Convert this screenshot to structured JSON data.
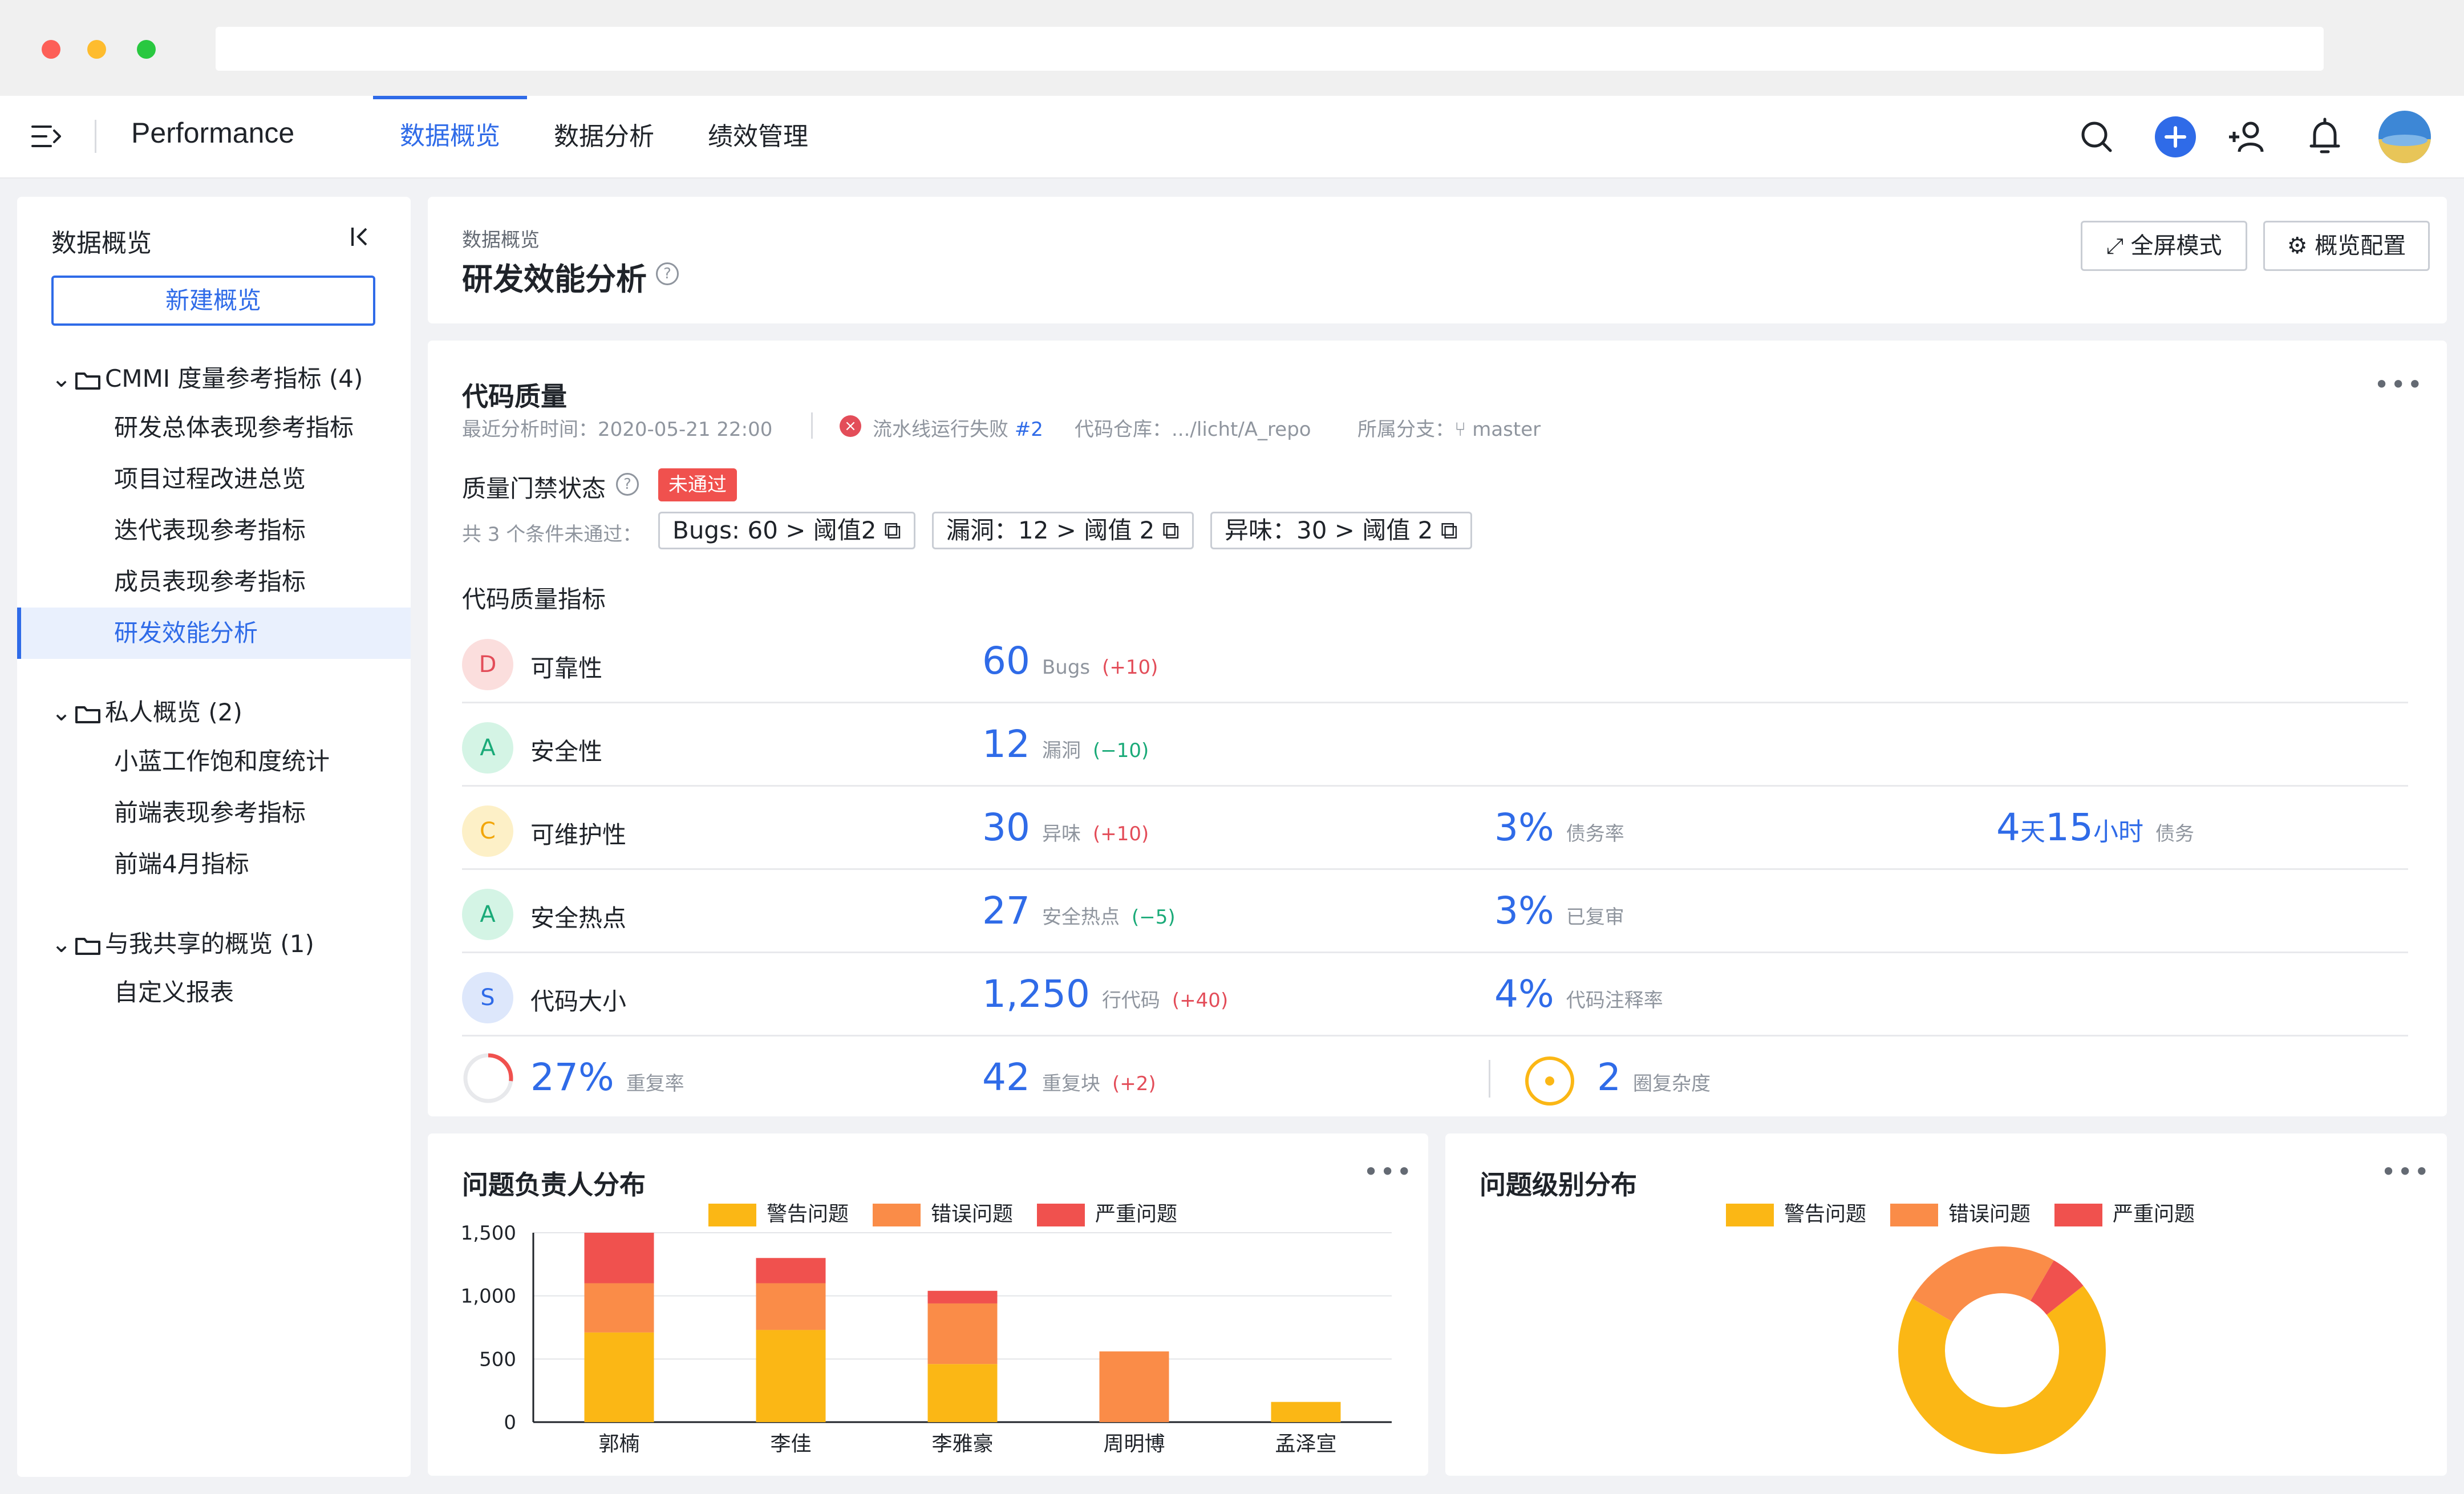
{
  "colors": {
    "accent": "#2f6be8",
    "warning": "#fbb715",
    "error": "#fa8c48",
    "critical": "#f0514e",
    "fail_badge": "#f0514e"
  },
  "header": {
    "app_title": "Performance",
    "tabs": [
      {
        "label": "数据概览",
        "active": true
      },
      {
        "label": "数据分析",
        "active": false
      },
      {
        "label": "绩效管理",
        "active": false
      }
    ],
    "icons": [
      "search-icon",
      "add-icon",
      "add-user-icon",
      "bell-icon",
      "avatar"
    ]
  },
  "sidebar": {
    "title": "数据概览",
    "new_button": "新建概览",
    "groups": [
      {
        "label": "CMMI 度量参考指标 (4)",
        "items": [
          "研发总体表现参考指标",
          "项目过程改进总览",
          "迭代表现参考指标",
          "成员表现参考指标",
          "研发效能分析"
        ]
      },
      {
        "label": "私人概览 (2)",
        "items": [
          "小蓝工作饱和度统计",
          "前端表现参考指标",
          "前端4月指标"
        ]
      },
      {
        "label": "与我共享的概览 (1)",
        "items": [
          "自定义报表"
        ]
      }
    ],
    "active_item": "研发效能分析"
  },
  "page": {
    "breadcrumb": "数据概览",
    "title": "研发效能分析",
    "fullscreen_button": "全屏模式",
    "config_button": "概览配置"
  },
  "code_quality": {
    "title": "代码质量",
    "analysis_time_label": "最近分析时间：",
    "analysis_time": "2020-05-21 22:00",
    "pipeline_status": "流水线运行失败",
    "pipeline_id": "#2",
    "repo_label": "代码仓库：",
    "repo": ".../licht/A_repo",
    "branch_label": "所属分支：",
    "branch": "master",
    "gate_label": "质量门禁状态",
    "gate_status": "未通过",
    "conditions_label": "共 3 个条件未通过：",
    "conditions": [
      "Bugs: 60 > 阈值2",
      "漏洞：12 > 阈值 2",
      "异味：30 > 阈值 2"
    ],
    "metrics_title": "代码质量指标",
    "rows": [
      {
        "grade": "D",
        "label": "可靠性",
        "v1": "60",
        "u1": "Bugs",
        "d1": "(+10)",
        "d1_dir": "up"
      },
      {
        "grade": "A",
        "label": "安全性",
        "v1": "12",
        "u1": "漏洞",
        "d1": "(−10)",
        "d1_dir": "down"
      },
      {
        "grade": "C",
        "label": "可维护性",
        "v1": "30",
        "u1": "异味",
        "d1": "(+10)",
        "d1_dir": "up",
        "v2": "3%",
        "u2": "债务率",
        "v3_a": "4",
        "v3_b": "天",
        "v3_c": "15",
        "v3_d": "小时",
        "u3": "债务"
      },
      {
        "grade": "A",
        "label": "安全热点",
        "v1": "27",
        "u1": "安全热点",
        "d1": "(−5)",
        "d1_dir": "down",
        "v2": "3%",
        "u2": "已复审"
      },
      {
        "grade": "S",
        "label": "代码大小",
        "v1": "1,250",
        "u1": "行代码",
        "d1": "(+40)",
        "d1_dir": "up",
        "v2": "4%",
        "u2": "代码注释率"
      }
    ],
    "last_row": {
      "dup_rate": "27%",
      "dup_rate_label": "重复率",
      "dup_rate_fraction": 0.27,
      "blocks": "42",
      "blocks_label": "重复块",
      "blocks_delta": "(+2)",
      "complexity": "2",
      "complexity_label": "圈复杂度"
    }
  },
  "owner_chart": {
    "title": "问题负责人分布",
    "legend": [
      "警告问题",
      "错误问题",
      "严重问题"
    ]
  },
  "level_chart": {
    "title": "问题级别分布",
    "legend": [
      "警告问题",
      "错误问题",
      "严重问题"
    ]
  },
  "chart_data": [
    {
      "type": "bar",
      "stacked": true,
      "title": "问题负责人分布",
      "categories": [
        "郭楠",
        "李佳",
        "李雅豪",
        "周明博",
        "孟泽宣"
      ],
      "series": [
        {
          "name": "警告问题",
          "color": "#fbb715",
          "values": [
            710,
            730,
            460,
            0,
            160
          ]
        },
        {
          "name": "错误问题",
          "color": "#fa8c48",
          "values": [
            390,
            370,
            480,
            560,
            0
          ]
        },
        {
          "name": "严重问题",
          "color": "#f0514e",
          "values": [
            400,
            200,
            100,
            0,
            0
          ]
        }
      ],
      "ylim": [
        0,
        1500
      ],
      "yticks": [
        "0",
        "500",
        "1,000",
        "1,500"
      ],
      "ytick_values": [
        0,
        500,
        1000,
        1500
      ],
      "grid": true,
      "legend_position": "top"
    },
    {
      "type": "pie",
      "donut": true,
      "title": "问题级别分布",
      "labels": [
        "警告问题",
        "错误问题",
        "严重问题"
      ],
      "colors": [
        "#fbb715",
        "#fa8c48",
        "#f0514e"
      ],
      "values": [
        69,
        25,
        6
      ],
      "legend_position": "top"
    }
  ]
}
